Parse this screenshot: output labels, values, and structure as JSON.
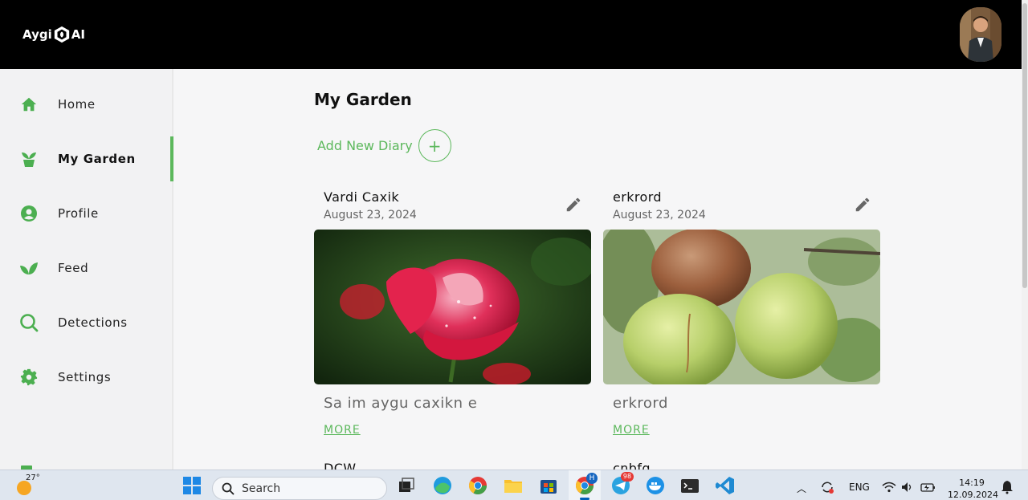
{
  "app": {
    "logo_left": "Aygi",
    "logo_right": "AI"
  },
  "sidebar": {
    "items": [
      {
        "label": "Home",
        "icon": "home-icon",
        "active": false
      },
      {
        "label": "My Garden",
        "icon": "plant-pot-icon",
        "active": true
      },
      {
        "label": "Profile",
        "icon": "user-circle-icon",
        "active": false
      },
      {
        "label": "Feed",
        "icon": "sprout-icon",
        "active": false
      },
      {
        "label": "Detections",
        "icon": "search-icon",
        "active": false
      },
      {
        "label": "Settings",
        "icon": "gear-icon",
        "active": false
      }
    ]
  },
  "main": {
    "title": "My Garden",
    "add_diary_label": "Add New Diary",
    "add_diary_icon": "+",
    "cards": [
      {
        "title": "Vardi Caxik",
        "date": "August 23, 2024",
        "description": "Sa im aygu caxikn e",
        "more": "MORE",
        "image": "red-rose-photo"
      },
      {
        "title": "erkrord",
        "date": "August 23, 2024",
        "description": "erkrord",
        "more": "MORE",
        "image": "pears-on-branch-photo"
      }
    ],
    "next_cards_peek": [
      "DCW",
      "cnbfq"
    ]
  },
  "taskbar": {
    "weather_temp": "27°",
    "search_placeholder": "Search",
    "telegram_badge": "98",
    "chrome_badge": "H",
    "language": "ENG",
    "time": "14:19",
    "date": "12.09.2024"
  },
  "colors": {
    "accent": "#5cb85c",
    "topbar": "#000000"
  }
}
